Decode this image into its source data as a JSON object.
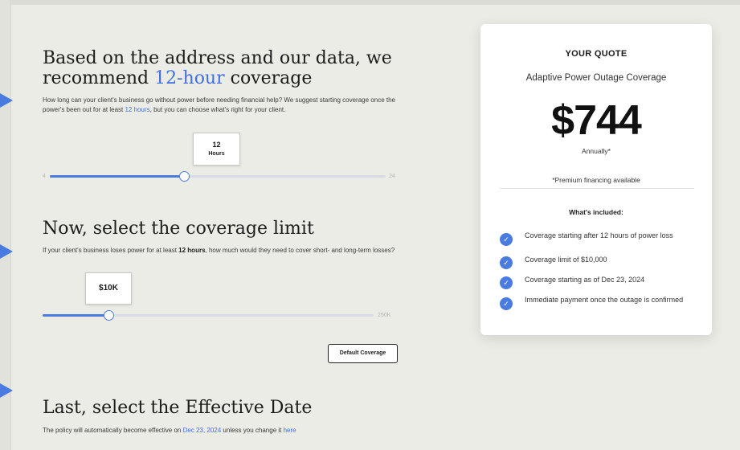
{
  "section1": {
    "heading_line1": "Based on the address and our data, we",
    "heading_pre": "recommend ",
    "heading_accent": "12-hour",
    "heading_post": " coverage",
    "para_pre": "How long can your client's business go without power before needing financial help? We suggest starting coverage once the power's been out for at least ",
    "para_link": "12 hours",
    "para_post": ", but you can choose what's right for your client.",
    "slider": {
      "value_number": "12",
      "value_unit": "Hours",
      "min_label": "4",
      "max_label": "24",
      "level_fraction": 0.4
    }
  },
  "section2": {
    "heading": "Now, select the coverage limit",
    "para_pre": "If your client's business loses power for at least ",
    "para_bold": "12 hours",
    "para_post": ", how much would they need to cover short- and long-term losses?",
    "slider": {
      "value": "$10K",
      "max_label": "250K",
      "level_fraction": 0.2
    },
    "default_button": "Default Coverage"
  },
  "section3": {
    "heading": "Last, select the Effective Date",
    "para_pre": "The policy will automatically become effective on ",
    "para_date": "Dec 23, 2024",
    "para_mid": " unless you change it ",
    "para_link": "here"
  },
  "quote": {
    "title": "YOUR QUOTE",
    "product": "Adaptive Power Outage Coverage",
    "price": "$744",
    "period": "Annually*",
    "financing": "*Premium financing available",
    "included_title": "What's included:",
    "items": [
      {
        "text": "Coverage starting after 12 hours of power loss",
        "icon": "check-circle-icon"
      },
      {
        "text": "Coverage limit of $10,000",
        "icon": "check-circle-icon"
      },
      {
        "text": "Coverage starting as of Dec 23, 2024",
        "icon": "check-circle-icon"
      },
      {
        "text": "Immediate payment once the outage is confirmed",
        "icon": "check-circle-icon"
      }
    ]
  },
  "colors": {
    "accent": "#4a7be0",
    "page_background": "#ecece6",
    "card_background": "#ffffff"
  }
}
